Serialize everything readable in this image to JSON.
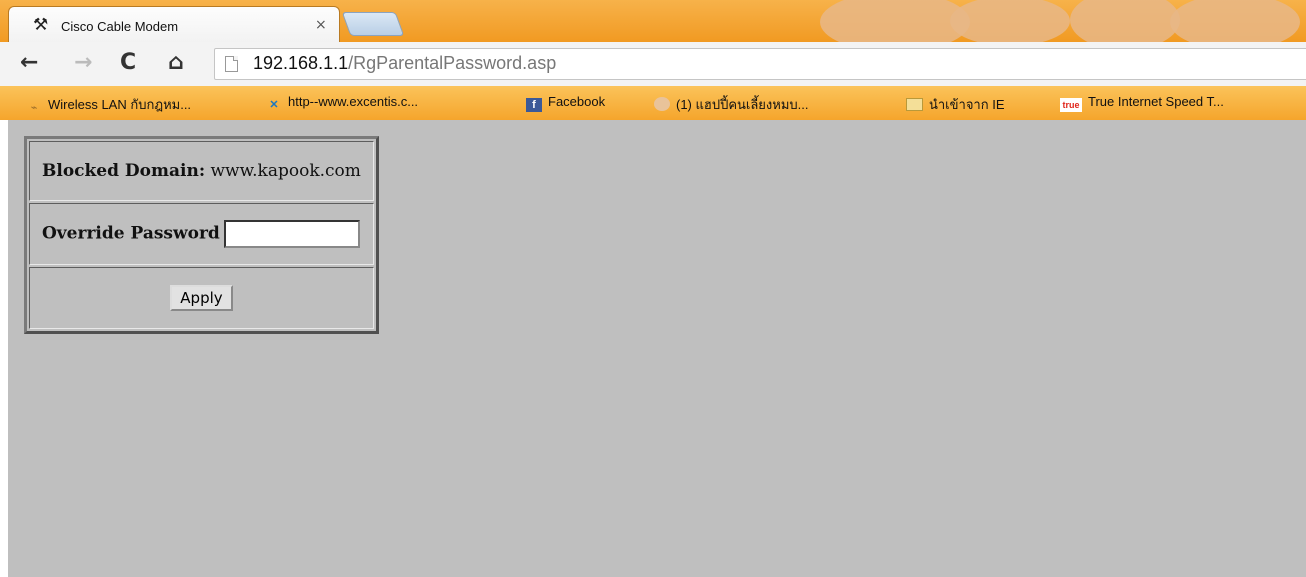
{
  "browser": {
    "tab_title": "Cisco Cable Modem",
    "tab_close": "×",
    "url_host": "192.168.1.1",
    "url_path": "/RgParentalPassword.asp",
    "nav_back": "←",
    "nav_forward": "→",
    "nav_reload": "C",
    "nav_home": "⌂",
    "bookmarks": [
      {
        "label": "Wireless LAN กับกฎหม...",
        "icon": "wireless-icon"
      },
      {
        "label": "http--www.excentis.c...",
        "icon": "excentis-icon"
      },
      {
        "label": "Facebook",
        "icon": "facebook-icon"
      },
      {
        "label": "(1) แฮปปี้คนเลี้ยงหมบ...",
        "icon": "game-icon"
      },
      {
        "label": "นำเข้าจาก IE",
        "icon": "folder-icon"
      },
      {
        "label": "True Internet Speed T...",
        "icon": "true-icon"
      }
    ]
  },
  "form": {
    "blocked_label": "Blocked Domain:",
    "blocked_value": "www.kapook.com",
    "override_label": "Override Password",
    "password_value": "",
    "apply_label": "Apply"
  },
  "colors": {
    "tabstrip": "#f19a22",
    "bookmarks_bar": "#f5a52c",
    "page_background": "#bfbfbf"
  }
}
